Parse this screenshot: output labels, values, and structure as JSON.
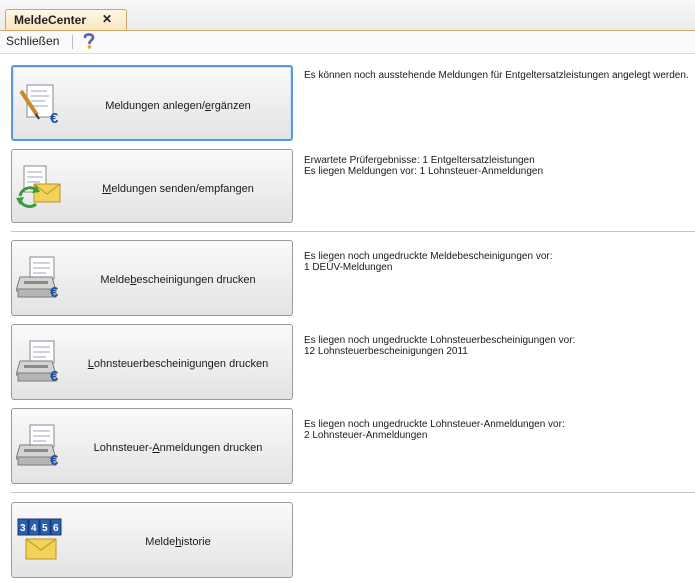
{
  "tab": {
    "title": "MeldeCenter",
    "close_glyph": "✕"
  },
  "toolbar": {
    "close_label": "Schließen",
    "help_icon": "help-icon"
  },
  "actions": [
    {
      "label_before": "Meldungen anlegen/",
      "label_hotkey": "e",
      "label_after": "rgänzen",
      "icon": "document-euro-pen-icon",
      "info": [
        "Es können noch ausstehende Meldungen für Entgeltersatzleistungen angelegt werden."
      ]
    },
    {
      "label_before": "",
      "label_hotkey": "M",
      "label_after": "eldungen senden/empfangen",
      "icon": "send-receive-envelope-icon",
      "info": [
        "Erwartete Prüfergebnisse: 1 Entgeltersatzleistungen",
        "Es liegen Meldungen vor: 1 Lohnsteuer-Anmeldungen"
      ]
    },
    {
      "label_before": "Melde",
      "label_hotkey": "b",
      "label_after": "escheinigungen drucken",
      "icon": "printer-document-euro-icon",
      "info": [
        "Es liegen noch ungedruckte Meldebescheinigungen vor:",
        "1 DEÜV-Meldungen"
      ]
    },
    {
      "label_before": "",
      "label_hotkey": "L",
      "label_after": "ohnsteuerbescheinigungen drucken",
      "icon": "printer-document-euro-icon",
      "info": [
        "Es liegen noch ungedruckte Lohnsteuerbescheinigungen vor:",
        "12 Lohnsteuerbescheinigungen 2011"
      ]
    },
    {
      "label_before": "Lohnsteuer-",
      "label_hotkey": "A",
      "label_after": "nmeldungen drucken",
      "icon": "printer-document-euro-icon",
      "info": [
        "Es liegen noch ungedruckte Lohnsteuer-Anmeldungen vor:",
        "2 Lohnsteuer-Anmeldungen"
      ]
    },
    {
      "label_before": "Melde",
      "label_hotkey": "h",
      "label_after": "istorie",
      "icon": "calendar-envelope-history-icon",
      "info": []
    }
  ],
  "history_icon_digits": [
    "3",
    "4",
    "5",
    "6"
  ],
  "colors": {
    "accent_tab": "#fbe6c1",
    "focus": "#5b9bd5",
    "euro": "#1f4e9a",
    "envelope": "#f2d25a",
    "arrow_green": "#3a9b3a"
  }
}
